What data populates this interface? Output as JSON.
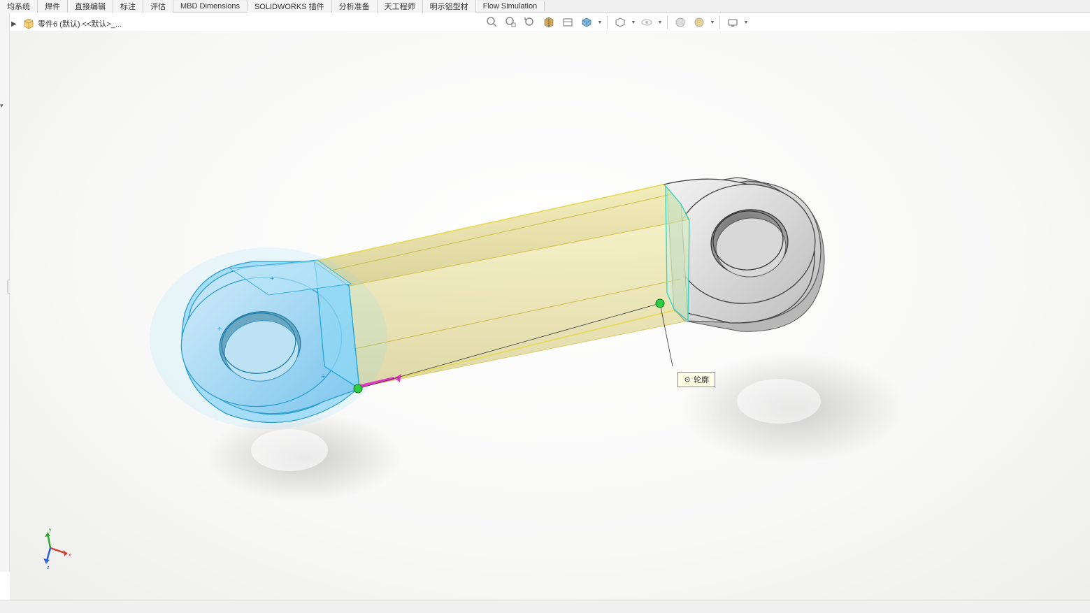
{
  "tabs": [
    {
      "label": "均系统"
    },
    {
      "label": "焊件"
    },
    {
      "label": "直接编辑"
    },
    {
      "label": "标注"
    },
    {
      "label": "评估"
    },
    {
      "label": "MBD Dimensions"
    },
    {
      "label": "SOLIDWORKS 插件"
    },
    {
      "label": "分析准备"
    },
    {
      "label": "天工程师"
    },
    {
      "label": "明示铝型材"
    },
    {
      "label": "Flow Simulation"
    }
  ],
  "breadcrumb": {
    "part_name": "零件6 (默认) <<默认>_..."
  },
  "heads_up": {
    "icons": [
      "zoom-to-fit-icon",
      "zoom-area-icon",
      "previous-view-icon",
      "section-view-icon",
      "view-orientation-icon",
      "display-style-icon",
      "hide-show-icon",
      "edit-appearance-icon",
      "apply-scene-icon",
      "view-settings-icon"
    ]
  },
  "tooltip": {
    "text": "轮廓"
  },
  "triad": {
    "x_label": "x",
    "y_label": "y",
    "z_label": "z"
  },
  "status": {
    "text": ""
  }
}
